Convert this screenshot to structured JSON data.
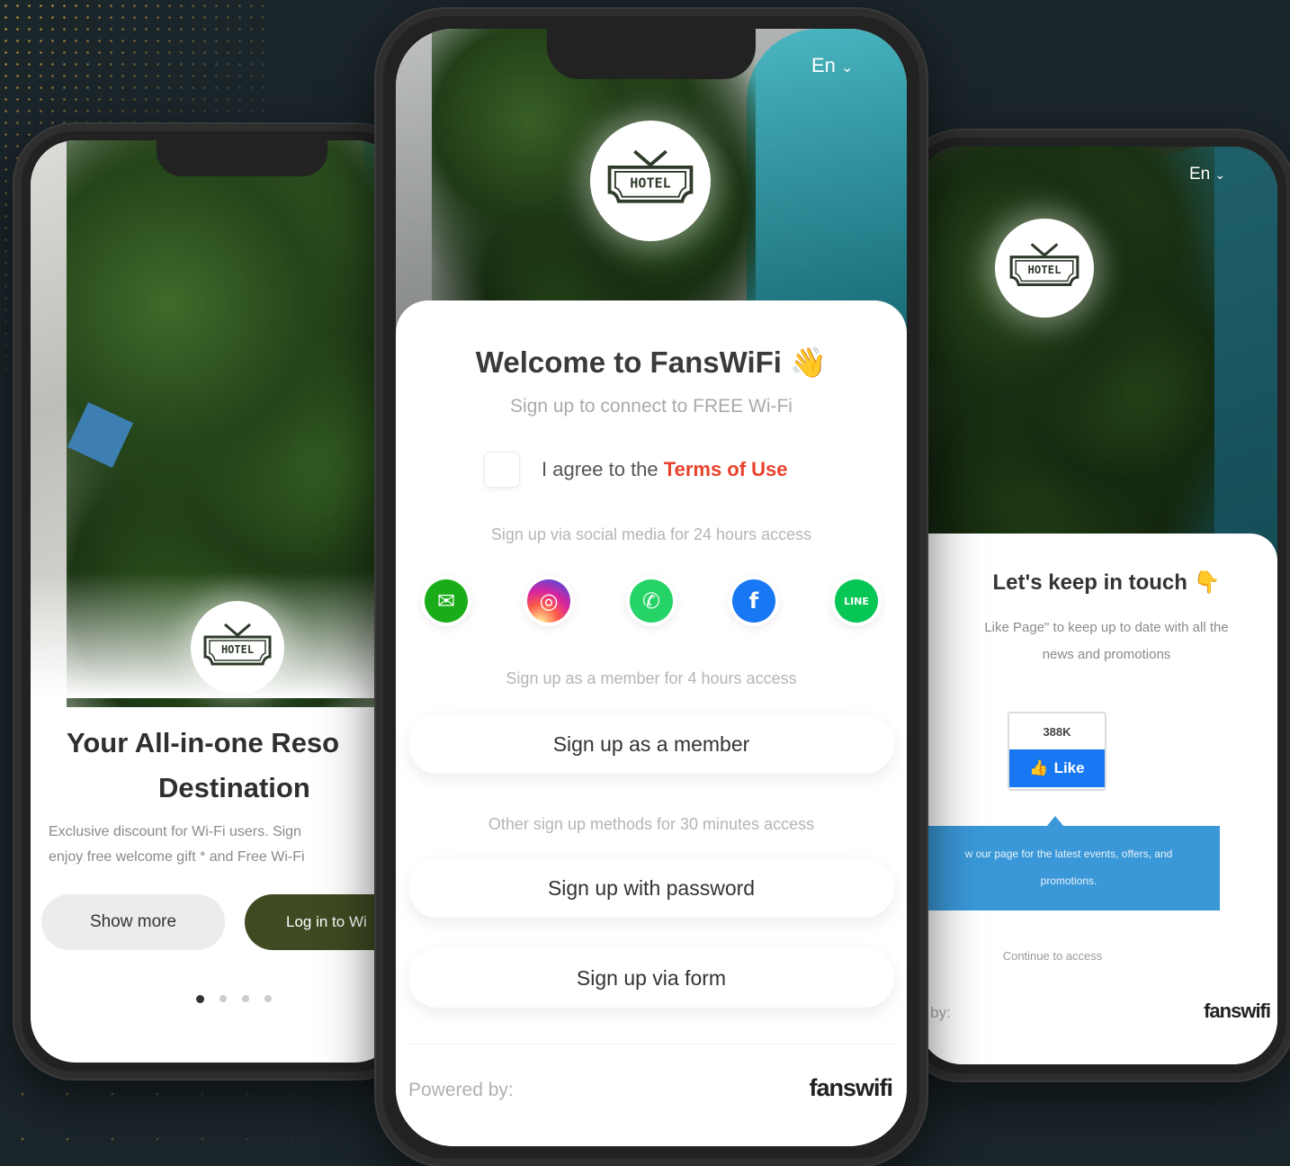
{
  "left_phone": {
    "headline_line1": "Your All-in-one Reso",
    "headline_line2": "Destination",
    "desc_line1": "Exclusive discount for Wi-Fi users. Sign",
    "desc_line2": "enjoy free welcome gift * and Free Wi-Fi",
    "show_more_label": "Show more",
    "login_label": "Log in to Wi",
    "logo_text": "HOTEL",
    "active_dot": 0
  },
  "center_phone": {
    "lang": "En",
    "logo_text": "HOTEL",
    "title": "Welcome to FansWiFi",
    "title_emoji": "👋",
    "subtitle": "Sign up to connect to FREE Wi-Fi",
    "agree_prefix": "I agree to the",
    "terms_link": "Terms of Use",
    "social_caption": "Sign up via social media for 24 hours access",
    "social": [
      {
        "name": "wechat",
        "color": "#1aad19",
        "glyph": "✉"
      },
      {
        "name": "instagram",
        "color": "#d6249f",
        "glyph": "◎"
      },
      {
        "name": "whatsapp",
        "color": "#25d366",
        "glyph": "✆"
      },
      {
        "name": "facebook",
        "color": "#1877f2",
        "glyph": "f"
      },
      {
        "name": "line",
        "color": "#06c755",
        "glyph": "LINE"
      }
    ],
    "member_caption": "Sign up as a member for 4 hours access",
    "member_button": "Sign up as a member",
    "other_caption": "Other sign up methods for 30 minutes access",
    "password_button": "Sign up with password",
    "form_button": "Sign up via form",
    "powered_by": "Powered by:",
    "brand": "fanswifi"
  },
  "right_phone": {
    "lang": "En",
    "logo_text": "HOTEL",
    "title": "Let's keep in touch",
    "title_emoji": "👇",
    "desc_line1": "Like Page\" to keep up to date with all the",
    "desc_line2": "news and promotions",
    "like_count": "388K",
    "like_label": "Like",
    "banner_line1": "w our page for the latest events, offers, and",
    "banner_line2": "promotions.",
    "continue_label": "Continue to access",
    "powered_by": "d by:",
    "brand": "fanswifi"
  },
  "colors": {
    "background": "#1b262b",
    "accent_red": "#e8412c",
    "olive_button": "#3f4a22",
    "fb_blue": "#1877f2",
    "banner_blue": "#3a98d8"
  }
}
